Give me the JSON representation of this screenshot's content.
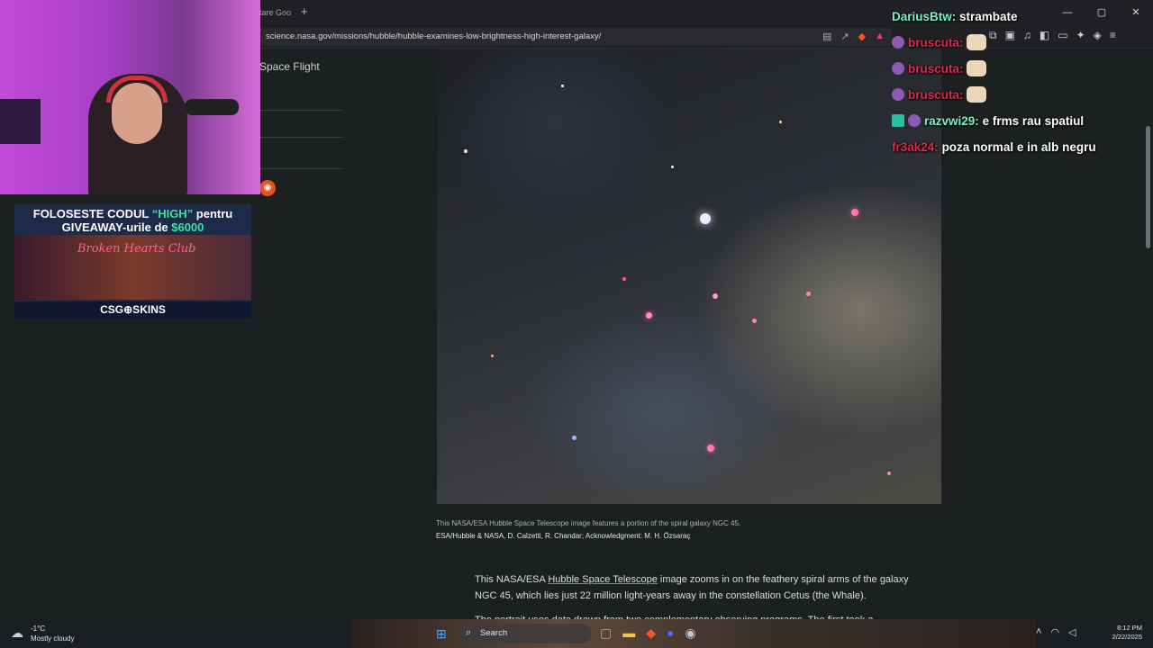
{
  "browser": {
    "tab_title": "tare Goo",
    "new_tab": "+",
    "window_controls": [
      "—",
      "▢",
      "✕"
    ],
    "url": "science.nasa.gov/missions/hubble/hubble-examines-low-brightness-high-interest-galaxy/",
    "url_icons": [
      "reader-icon",
      "share-icon",
      "brave-shields-icon",
      "brave-rewards-icon"
    ],
    "toolbar_icons": [
      "extension-icon",
      "screenshot-icon",
      "media-icon",
      "sidebar-icon",
      "wallet-icon",
      "leo-icon",
      "vpn-icon",
      "menu-icon"
    ]
  },
  "page": {
    "nav_label": "Space Flight",
    "rss_icon": "rss-icon",
    "caption": "This NASA/ESA Hubble Space Telescope image features a portion of the spiral galaxy NGC 45.",
    "credit": "ESA/Hubble & NASA, D. Calzetti, R. Chandar; Acknowledgment: M. H. Özsaraç",
    "para_part1": "This NASA/ESA ",
    "para_link": "Hubble Space Telescope",
    "para_part2": " image zooms in on the feathery spiral arms of the galaxy NGC 45, which lies just 22 million light-years away in the constellation Cetus (the Whale).",
    "para2": "The portrait uses data drawn from two complementary observing programs. The first took a"
  },
  "ad": {
    "line1_a": "FOLOSESTE CODUL ",
    "line1_b": "“HIGH”",
    "line1_c": " pentru",
    "line2_a": "GIVEAWAY-urile de ",
    "line2_b": "$6000",
    "club": "Broken Hearts Club",
    "footer": "CSG⊕SKINS",
    "accent": "#3fe0a0"
  },
  "chat": [
    {
      "user": "DariusBtw:",
      "text": "strambate",
      "badge": ""
    },
    {
      "user": "bruscuta:",
      "text": "",
      "badge": "purple"
    },
    {
      "user": "bruscuta:",
      "text": "",
      "badge": "purple"
    },
    {
      "user": "bruscuta:",
      "text": "",
      "badge": "purple"
    },
    {
      "user": "razvwi29:",
      "text": "e frms rau spatiul",
      "badge": "green"
    },
    {
      "user": "fr3ak24:",
      "text": "poza normal e in alb negru",
      "badge": ""
    }
  ],
  "taskbar": {
    "weather_temp": "-1°C",
    "weather_desc": "Mostly cloudy",
    "search_label": "Search",
    "clock_time": "8:12 PM",
    "clock_date": "2/22/2025"
  }
}
